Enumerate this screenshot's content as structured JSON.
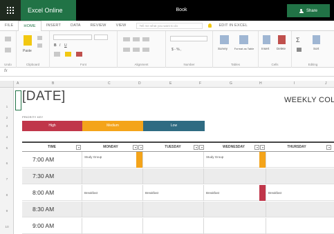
{
  "titlebar": {
    "brand": "Excel Online",
    "document": "Book",
    "share_label": "Share",
    "accent": "#217346"
  },
  "ribbon": {
    "tabs": [
      "FILE",
      "HOME",
      "INSERT",
      "DATA",
      "REVIEW",
      "VIEW"
    ],
    "active_tab": "HOME",
    "tellme_placeholder": "Tell me what you want to do",
    "edit_in_excel": "EDIT IN EXCEL",
    "groups": [
      "Undo",
      "Clipboard",
      "Font",
      "Alignment",
      "Number",
      "Tables",
      "Cells",
      "Editing"
    ],
    "buttons": {
      "paste": "Paste",
      "survey": "Survey",
      "format_as_table": "Format as Table",
      "insert": "Insert",
      "delete": "Delete",
      "sort": "Sort",
      "number_format": "$ - % ,"
    }
  },
  "formula_bar": {
    "fx": "fx"
  },
  "grid": {
    "columns": [
      "A",
      "B",
      "C",
      "D",
      "E",
      "F",
      "G",
      "H",
      "I",
      "J"
    ],
    "rows": [
      "1",
      "2",
      "3",
      "4",
      "5",
      "6",
      "7",
      "8",
      "9",
      "10"
    ]
  },
  "sheet": {
    "date": "[DATE]",
    "title": "WEEKLY COL",
    "priority_key_label": "PRIORITY KEY",
    "priorities": [
      {
        "label": "High",
        "color": "#c0364a"
      },
      {
        "label": "Medium",
        "color": "#f4a41a"
      },
      {
        "label": "Low",
        "color": "#2f6b82"
      }
    ],
    "headers": [
      "TIME",
      "MONDAY",
      "TUESDAY",
      "WEDNESDAY",
      "THURSDAY"
    ],
    "schedule": [
      {
        "time": "7:00 AM",
        "mon": "Study Group",
        "tue": "",
        "wed": "Study Group",
        "thu": ""
      },
      {
        "time": "7:30 AM",
        "mon": "",
        "tue": "",
        "wed": "",
        "thu": ""
      },
      {
        "time": "8:00 AM",
        "mon": "Breakfast",
        "tue": "Breakfast",
        "wed": "Breakfast",
        "thu": "Breakfast"
      },
      {
        "time": "8:30 AM",
        "mon": "",
        "tue": "",
        "wed": "",
        "thu": ""
      },
      {
        "time": "9:00 AM",
        "mon": "",
        "tue": "",
        "wed": "",
        "thu": ""
      }
    ]
  }
}
